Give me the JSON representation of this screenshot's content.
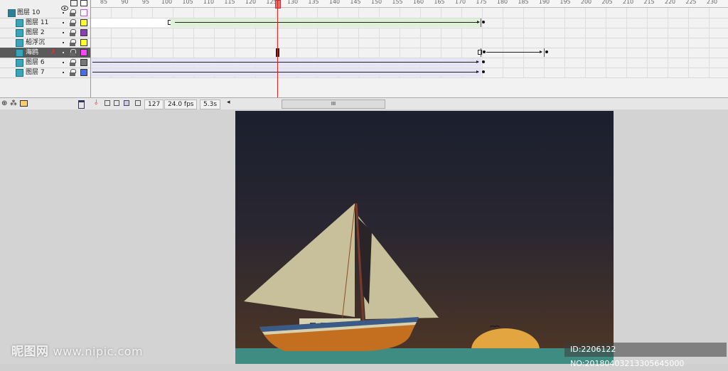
{
  "timeline": {
    "ruler_labels": [
      "85",
      "90",
      "95",
      "100",
      "105",
      "110",
      "115",
      "120",
      "125",
      "130",
      "135",
      "140",
      "145",
      "150",
      "155",
      "160",
      "165",
      "170",
      "175",
      "180",
      "185",
      "190",
      "195",
      "200",
      "205",
      "210",
      "215",
      "220",
      "225",
      "230"
    ],
    "current_frame_marker": "127",
    "layers": [
      {
        "name": "图层 10",
        "color": "#c050d8"
      },
      {
        "name": "图层 11",
        "color": "#ffff33"
      },
      {
        "name": "图层 2",
        "color": "#8a3fb8"
      },
      {
        "name": "船浮沉",
        "color": "#ffff33"
      },
      {
        "name": "海鸥",
        "color": "#ff44ff"
      },
      {
        "name": "图层 6",
        "color": "#777777"
      },
      {
        "name": "图层 7",
        "color": "#4a6ee0"
      }
    ]
  },
  "status": {
    "current_frame": "127",
    "fps": "24.0 fps",
    "elapsed": "5.3s",
    "scroll_grip": "III"
  },
  "watermark": {
    "brand": "昵图网",
    "site": "www.nipic.com",
    "id_text": "ID:2206122 NO:20180403213305645000"
  },
  "colors": {
    "sky_top": "#1b1f2e",
    "sky_bottom": "#4a3322",
    "sea": "#3f8c82",
    "sun": "#e2a540",
    "sail": "#c8c09a",
    "hull": "#c46f20",
    "hull_stripe": "#3a5a88",
    "cabin": "#d6d1b0"
  },
  "icons": {
    "eye": "eye-icon",
    "lock": "lock-icon",
    "outline": "outline-icon",
    "trash": "trash-icon",
    "new_layer": "new-layer-icon",
    "onion_skin": "onion-skin-icon",
    "edit_markers": "edit-markers-icon"
  }
}
